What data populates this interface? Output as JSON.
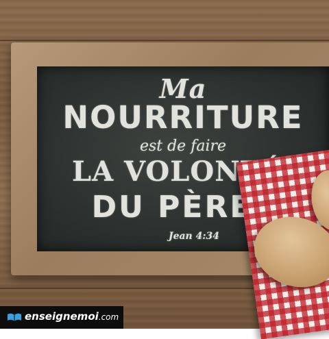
{
  "chalkboard": {
    "line1": "Ma",
    "line2": "NOURRITURE",
    "line3": "est de faire",
    "line4": "LA VOLONTÉ",
    "line5": "DU PÈRE",
    "reference": "Jean 4:34"
  },
  "watermark": {
    "name": "enseignemoi",
    "suffix": ".com"
  },
  "colors": {
    "chalk": "#e2e2dc",
    "board": "#2d3230",
    "frame": "#a88a6b",
    "cloth_red": "#be1e28",
    "logo_bg": "#0d0d0d"
  }
}
